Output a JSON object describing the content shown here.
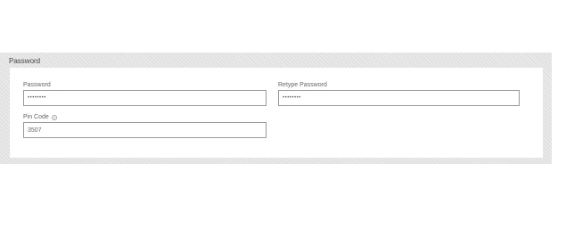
{
  "section": {
    "title": "Password"
  },
  "fields": {
    "password": {
      "label": "Password",
      "value": "••••••••"
    },
    "retype_password": {
      "label": "Retype Password",
      "value": "••••••••"
    },
    "pin_code": {
      "label": "Pin Code",
      "value": "3507",
      "info_icon": "info-icon"
    }
  }
}
